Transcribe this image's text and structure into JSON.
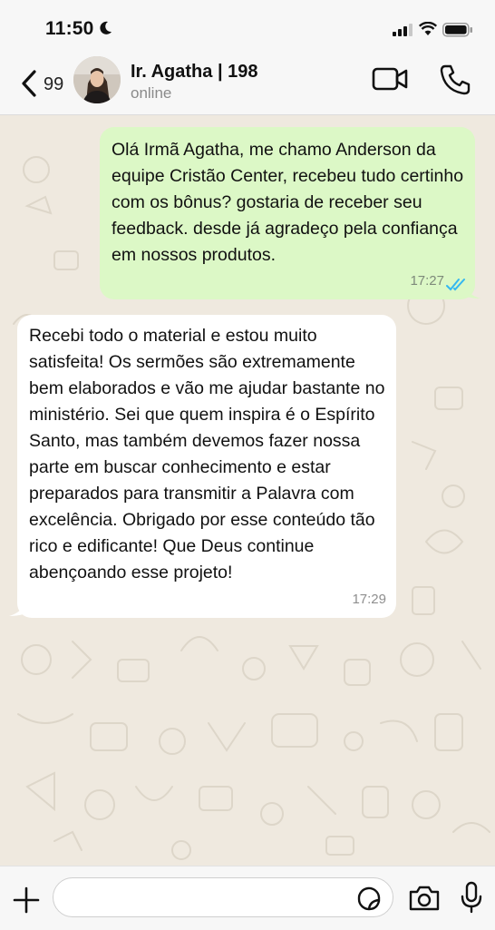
{
  "status_bar": {
    "time": "11:50",
    "moon_icon": "moon-icon",
    "signal_icon": "cellular-signal-icon",
    "wifi_icon": "wifi-icon",
    "battery_icon": "battery-icon"
  },
  "header": {
    "back_count": "99",
    "contact_name": "Ir. Agatha | 198",
    "contact_status": "online",
    "video_icon": "video-call-icon",
    "call_icon": "phone-call-icon"
  },
  "messages": [
    {
      "direction": "outgoing",
      "text": "Olá Irmã Agatha, me chamo Anderson da equipe Cristão Center, recebeu tudo certinho com os bônus? gostaria de receber seu feedback. desde já agradeço pela confiança em nossos produtos.",
      "time": "17:27",
      "read_status": "read",
      "tick_color": "#34b7f1"
    },
    {
      "direction": "incoming",
      "text": "Recebi todo o material e estou muito satisfeita! Os sermões são extremamente bem elaborados e vão me ajudar bastante no ministério. Sei que quem inspira é o Espírito Santo, mas também devemos fazer nossa parte em buscar conhecimento e estar preparados para transmitir a Palavra com excelência. Obrigado por esse conteúdo tão rico e edificante! Que Deus continue abençoando esse projeto!",
      "time": "17:29"
    }
  ],
  "input_bar": {
    "placeholder": "",
    "value": "",
    "plus_icon": "plus-icon",
    "sticker_icon": "sticker-icon",
    "camera_icon": "camera-icon",
    "mic_icon": "microphone-icon"
  },
  "colors": {
    "outgoing_bubble": "#dcf8c6",
    "incoming_bubble": "#ffffff",
    "chat_background": "#efe9df"
  }
}
